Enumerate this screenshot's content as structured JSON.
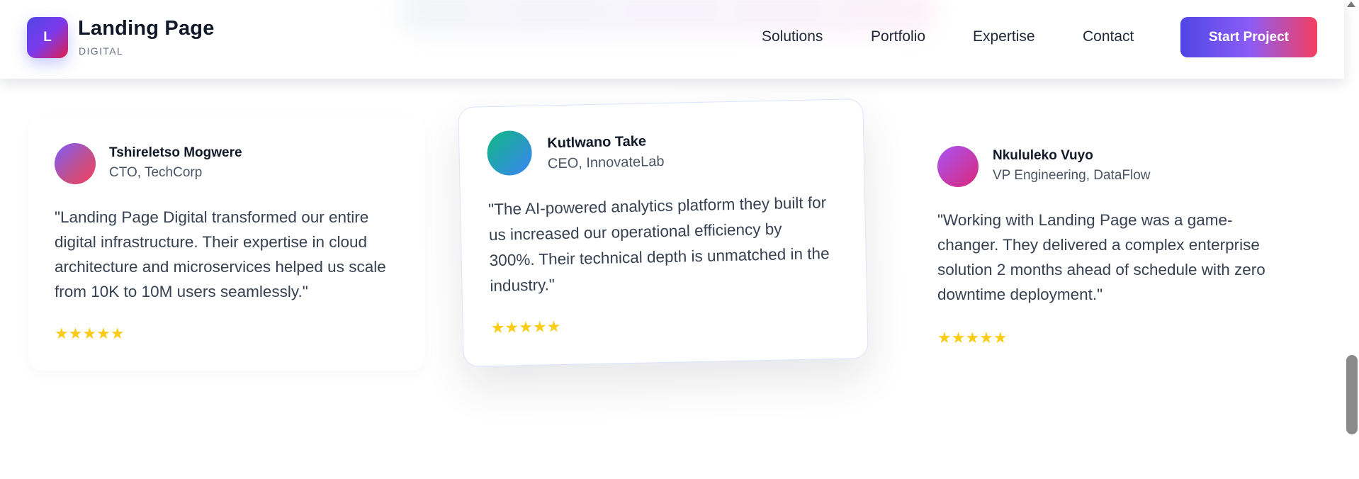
{
  "header": {
    "logo_letter": "L",
    "brand_title": "Landing Page",
    "brand_subtitle": "DIGITAL",
    "nav": [
      "Solutions",
      "Portfolio",
      "Expertise",
      "Contact"
    ],
    "cta_label": "Start Project"
  },
  "testimonials": [
    {
      "name": "Tshireletso Mogwere",
      "role": "CTO, TechCorp",
      "quote": "\"Landing Page Digital transformed our entire digital infrastructure. Their expertise in cloud architecture and microservices helped us scale from 10K to 10M users seamlessly.\"",
      "stars": "★★★★★",
      "rating": 5
    },
    {
      "name": "Kutlwano Take",
      "role": "CEO, InnovateLab",
      "quote": "\"The AI-powered analytics platform they built for us increased our operational efficiency by 300%. Their technical depth is unmatched in the industry.\"",
      "stars": "★★★★★",
      "rating": 5
    },
    {
      "name": "Nkululeko Vuyo",
      "role": "VP Engineering, DataFlow",
      "quote": "\"Working with Landing Page was a game-changer. They delivered a complex enterprise solution 2 months ahead of schedule with zero downtime deployment.\"",
      "stars": "★★★★★",
      "rating": 5
    }
  ],
  "colors": {
    "accent_start": "#4f46e5",
    "accent_end": "#f43f5e",
    "star": "#facc15"
  }
}
